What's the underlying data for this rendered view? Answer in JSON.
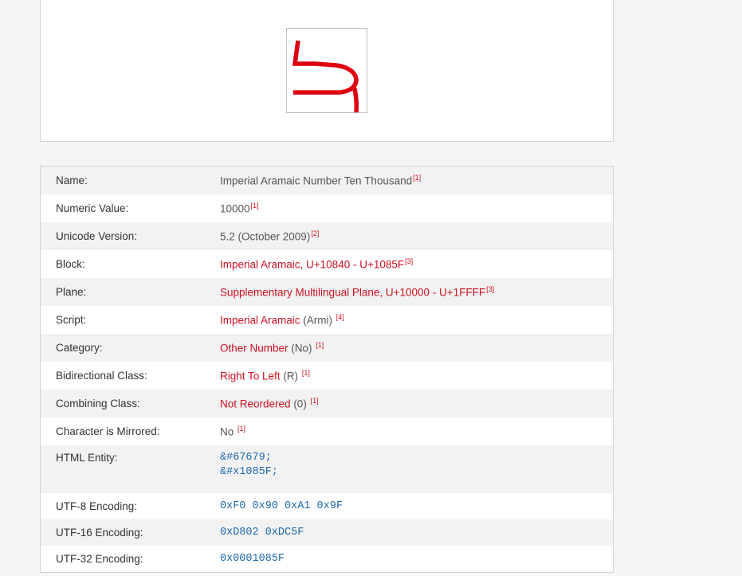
{
  "glyph": {
    "icon": "imperial-aramaic-number-ten-thousand-glyph",
    "color": "#dd0011"
  },
  "rows": {
    "name": {
      "label": "Name:",
      "value": "Imperial Aramaic Number Ten Thousand",
      "ref": "[1]"
    },
    "numeric": {
      "label": "Numeric Value:",
      "value": "10000",
      "ref": "[1]"
    },
    "version": {
      "label": "Unicode Version:",
      "value": "5.2 (October 2009)",
      "ref": "[2]"
    },
    "block": {
      "label": "Block:",
      "value": "Imperial Aramaic, U+10840 - U+1085F",
      "ref": "[3]"
    },
    "plane": {
      "label": "Plane:",
      "value": "Supplementary Multilingual Plane, U+10000 - U+1FFFF",
      "ref": "[3]"
    },
    "script": {
      "label": "Script:",
      "link": "Imperial Aramaic",
      "suffix": " (Armi) ",
      "ref": "[4]"
    },
    "category": {
      "label": "Category:",
      "link": "Other Number",
      "suffix": " (No) ",
      "ref": "[1]"
    },
    "bidi": {
      "label": "Bidirectional Class:",
      "link": "Right To Left",
      "suffix": " (R) ",
      "ref": "[1]"
    },
    "combining": {
      "label": "Combining Class:",
      "link": "Not Reordered",
      "suffix": " (0) ",
      "ref": "[1]"
    },
    "mirrored": {
      "label": "Character is Mirrored:",
      "value": "No ",
      "ref": "[1]"
    },
    "html_entity": {
      "label": "HTML Entity:",
      "dec": "&#67679;",
      "hex": "&#x1085F;"
    },
    "utf8": {
      "label": "UTF-8 Encoding:",
      "value": "0xF0 0x90 0xA1 0x9F"
    },
    "utf16": {
      "label": "UTF-16 Encoding:",
      "value": "0xD802 0xDC5F"
    },
    "utf32": {
      "label": "UTF-32 Encoding:",
      "value": "0x0001085F"
    }
  }
}
